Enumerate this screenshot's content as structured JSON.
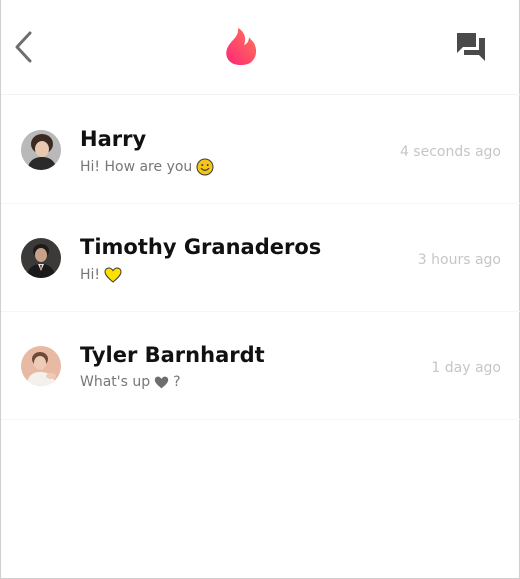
{
  "header": {
    "back_icon": "chevron-left-icon",
    "logo_icon": "flame-icon",
    "chat_icon": "chat-bubbles-icon",
    "accent_color": "#fd5068"
  },
  "conversations": [
    {
      "name": "Harry",
      "message": "Hi! How are you",
      "message_emoji": "smiley-face-icon",
      "time": "4 seconds ago"
    },
    {
      "name": "Timothy Granaderos",
      "message": "Hi!",
      "message_emoji": "yellow-heart-icon",
      "time": "3 hours ago"
    },
    {
      "name": "Tyler Barnhardt",
      "message": "What's up",
      "message_emoji": "gray-heart-icon",
      "message_suffix": "?",
      "time": "1 day ago"
    }
  ]
}
